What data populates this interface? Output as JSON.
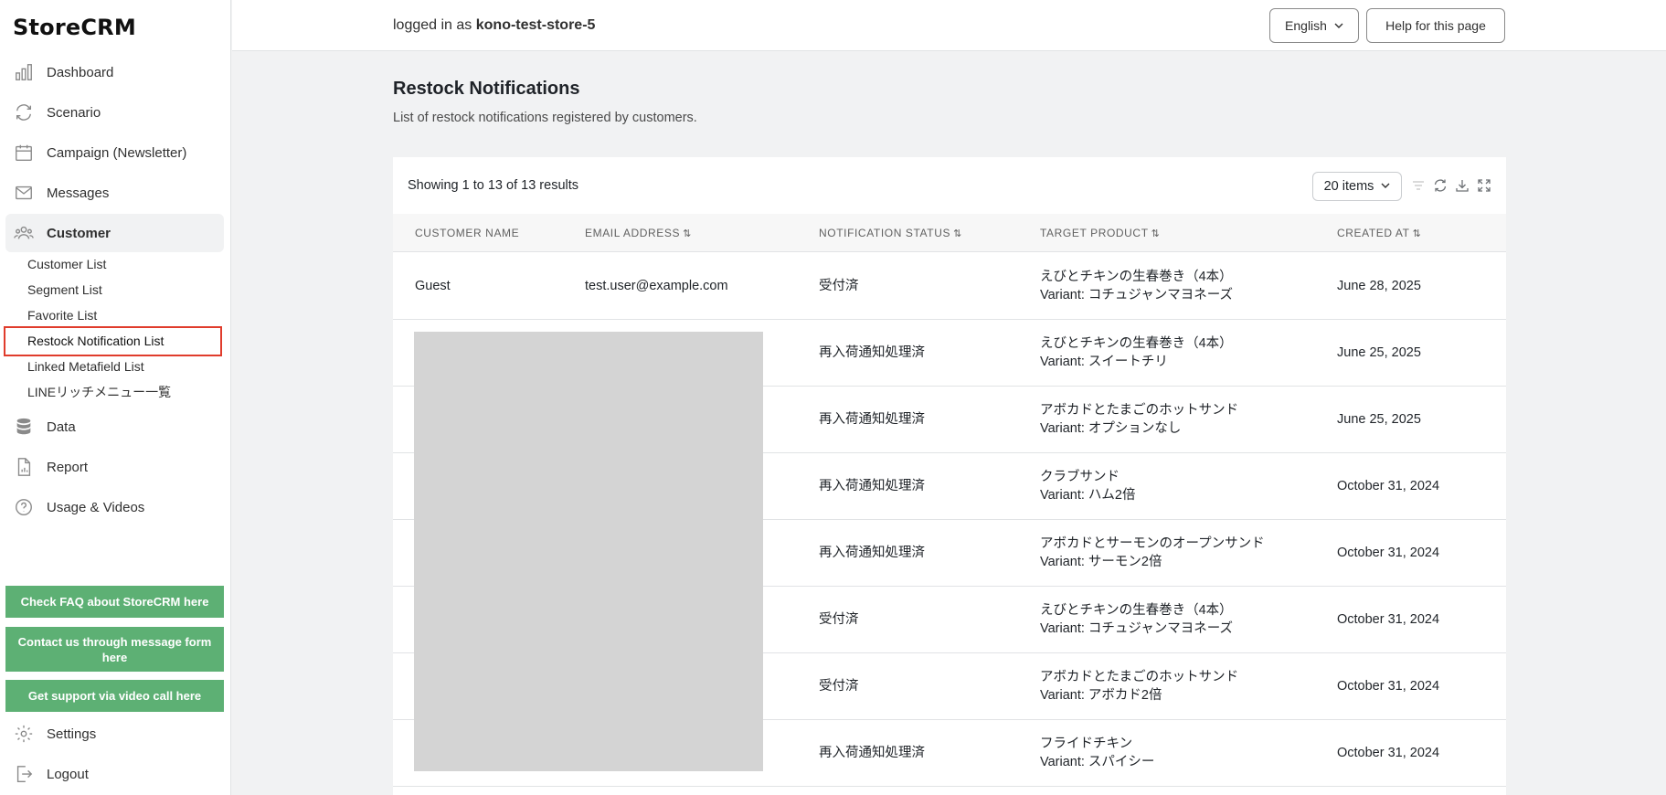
{
  "app": {
    "title": "StoreCRM"
  },
  "sidebar": {
    "items": [
      {
        "label": "Dashboard",
        "icon": "bar-chart-icon"
      },
      {
        "label": "Scenario",
        "icon": "refresh-icon"
      },
      {
        "label": "Campaign (Newsletter)",
        "icon": "calendar-icon"
      },
      {
        "label": "Messages",
        "icon": "mail-icon"
      },
      {
        "label": "Customer",
        "icon": "people-icon"
      }
    ],
    "customer_sub": [
      {
        "label": "Customer List"
      },
      {
        "label": "Segment List"
      },
      {
        "label": "Favorite List"
      },
      {
        "label": "Restock Notification List"
      },
      {
        "label": "Linked Metafield List"
      },
      {
        "label": "LINEリッチメニュー一覧"
      }
    ],
    "items2": [
      {
        "label": "Data",
        "icon": "database-icon"
      },
      {
        "label": "Report",
        "icon": "report-icon"
      },
      {
        "label": "Usage & Videos",
        "icon": "help-icon"
      }
    ],
    "help_buttons": [
      {
        "label": "Check FAQ about StoreCRM here"
      },
      {
        "label": "Contact us through message form here"
      },
      {
        "label": "Get support via video call here"
      }
    ],
    "bottom": [
      {
        "label": "Settings",
        "icon": "gear-icon"
      },
      {
        "label": "Logout",
        "icon": "logout-icon"
      }
    ]
  },
  "header": {
    "logged_prefix": "logged in as",
    "store": "kono-test-store-5",
    "language": "English",
    "help_label": "Help for this page"
  },
  "page": {
    "title": "Restock Notifications",
    "subtitle": "List of restock notifications registered by customers."
  },
  "table": {
    "showing": "Showing 1 to 13 of 13 results",
    "page_size": "20 items",
    "columns": [
      "CUSTOMER NAME",
      "EMAIL ADDRESS",
      "NOTIFICATION STATUS",
      "TARGET PRODUCT",
      "CREATED AT"
    ],
    "rows": [
      {
        "name": "Guest",
        "email": "test.user@example.com",
        "status": "受付済",
        "product": "えびとチキンの生春巻き（4本）",
        "variant": "Variant: コチュジャンマヨネーズ",
        "created": "June 28, 2025"
      },
      {
        "name": "",
        "email": "",
        "status": "再入荷通知処理済",
        "product": "えびとチキンの生春巻き（4本）",
        "variant": "Variant: スイートチリ",
        "created": "June 25, 2025"
      },
      {
        "name": "",
        "email": "",
        "status": "再入荷通知処理済",
        "product": "アボカドとたまごのホットサンド",
        "variant": "Variant: オプションなし",
        "created": "June 25, 2025"
      },
      {
        "name": "",
        "email": "",
        "status": "再入荷通知処理済",
        "product": "クラブサンド",
        "variant": "Variant: ハム2倍",
        "created": "October 31, 2024"
      },
      {
        "name": "",
        "email": "",
        "status": "再入荷通知処理済",
        "product": "アボカドとサーモンのオープンサンド",
        "variant": "Variant: サーモン2倍",
        "created": "October 31, 2024"
      },
      {
        "name": "",
        "email": "",
        "status": "受付済",
        "product": "えびとチキンの生春巻き（4本）",
        "variant": "Variant: コチュジャンマヨネーズ",
        "created": "October 31, 2024"
      },
      {
        "name": "",
        "email": "",
        "status": "受付済",
        "product": "アボカドとたまごのホットサンド",
        "variant": "Variant: アボカド2倍",
        "created": "October 31, 2024"
      },
      {
        "name": "",
        "email": "",
        "status": "再入荷通知処理済",
        "product": "フライドチキン",
        "variant": "Variant: スパイシー",
        "created": "October 31, 2024"
      }
    ]
  },
  "colors": {
    "accent_green": "#5db074",
    "highlight_red": "#e03c2c"
  }
}
